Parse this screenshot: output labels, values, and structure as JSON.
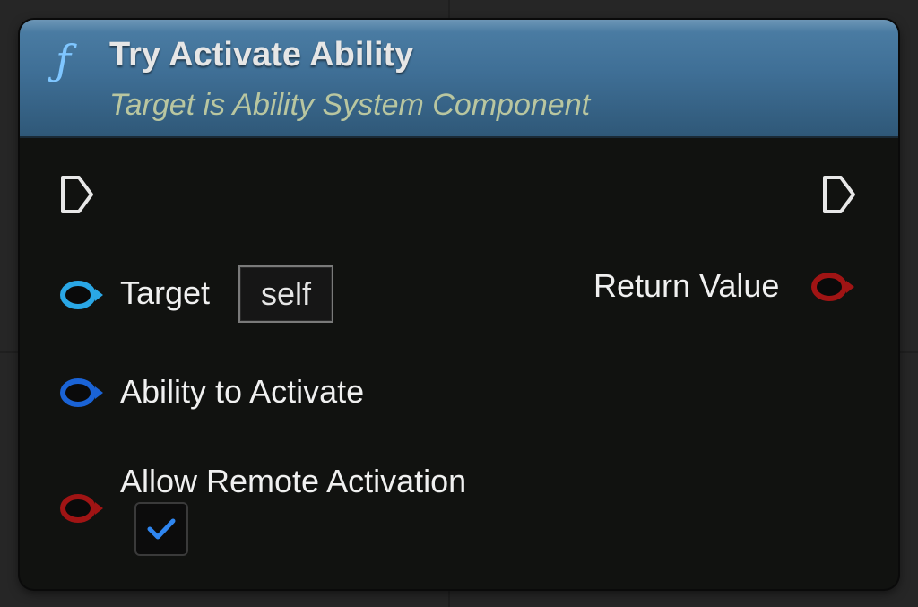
{
  "node": {
    "icon": "function-icon",
    "icon_glyph": "ƒ",
    "title": "Try Activate Ability",
    "subtitle": "Target is Ability System Component"
  },
  "pins": {
    "exec_in": {
      "icon": "exec-in-pin-icon"
    },
    "exec_out": {
      "icon": "exec-out-pin-icon"
    },
    "target": {
      "label": "Target",
      "default_value": "self",
      "color": "#2aa7e6"
    },
    "ability": {
      "label": "Ability to Activate",
      "color": "#1a63d6"
    },
    "allow_remote": {
      "label": "Allow Remote Activation",
      "color": "#a01414",
      "checked": true
    },
    "return_value": {
      "label": "Return Value",
      "color": "#a01414"
    }
  },
  "colors": {
    "header": "#3f6f96",
    "body": "#111210",
    "check": "#2f86f0"
  }
}
